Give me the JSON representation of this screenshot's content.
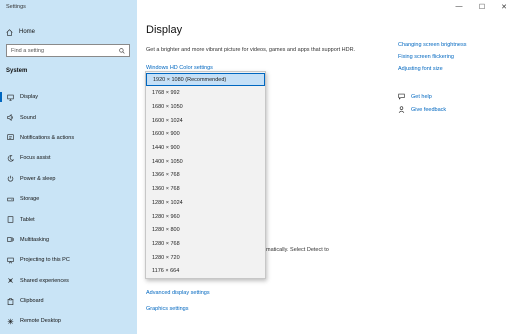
{
  "window": {
    "title": "Settings",
    "minimize": "—",
    "maximize": "☐",
    "close": "✕"
  },
  "sidebar": {
    "home_label": "Home",
    "search_placeholder": "Find a setting",
    "section_title": "System",
    "items": [
      {
        "label": "Display",
        "icon": "monitor-icon",
        "active": true
      },
      {
        "label": "Sound",
        "icon": "speaker-icon"
      },
      {
        "label": "Notifications & actions",
        "icon": "notifications-icon"
      },
      {
        "label": "Focus assist",
        "icon": "moon-icon"
      },
      {
        "label": "Power & sleep",
        "icon": "power-icon"
      },
      {
        "label": "Storage",
        "icon": "storage-icon"
      },
      {
        "label": "Tablet",
        "icon": "tablet-icon"
      },
      {
        "label": "Multitasking",
        "icon": "multitasking-icon"
      },
      {
        "label": "Projecting to this PC",
        "icon": "projecting-icon"
      },
      {
        "label": "Shared experiences",
        "icon": "shared-icon"
      },
      {
        "label": "Clipboard",
        "icon": "clipboard-icon"
      },
      {
        "label": "Remote Desktop",
        "icon": "remote-desktop-icon"
      }
    ]
  },
  "main": {
    "title": "Display",
    "description": "Get a brighter and more vibrant picture for videos, games and apps that support HDR.",
    "hdr_link": "Windows HD Color settings",
    "detect_text": "matically. Select Detect to",
    "advanced_link": "Advanced display settings",
    "graphics_link": "Graphics settings"
  },
  "resolution_dropdown": {
    "selected": "1920 × 1080 (Recommended)",
    "options": [
      "1920 × 1080 (Recommended)",
      "1768 × 992",
      "1680 × 1050",
      "1600 × 1024",
      "1600 × 900",
      "1440 × 900",
      "1400 × 1050",
      "1366 × 768",
      "1360 × 768",
      "1280 × 1024",
      "1280 × 960",
      "1280 × 800",
      "1280 × 768",
      "1280 × 720",
      "1176 × 664"
    ]
  },
  "right_panel": {
    "links": [
      "Changing screen brightness",
      "Fixing screen flickering",
      "Adjusting font size"
    ],
    "get_help": "Get help",
    "give_feedback": "Give feedback"
  },
  "colors": {
    "sidebar_bg": "#c9e4f6",
    "accent": "#0067c0",
    "dropdown_bg": "#f2f2f2",
    "selected_bg": "#c5e0f7"
  }
}
